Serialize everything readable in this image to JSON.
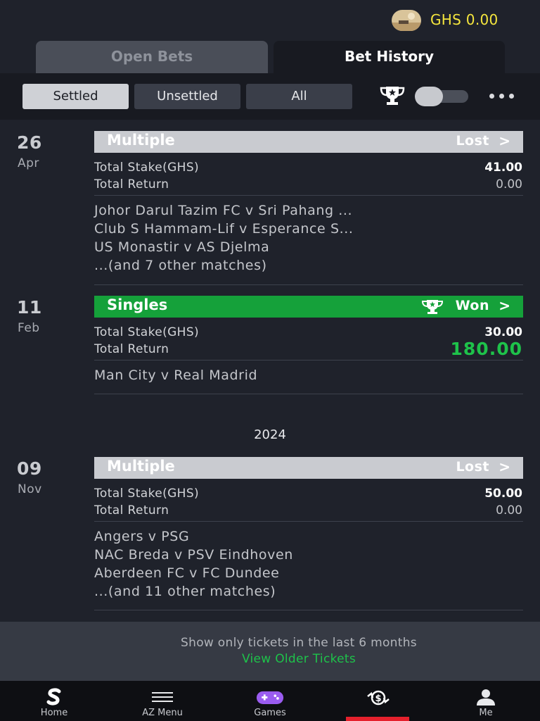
{
  "header": {
    "balance": "GHS 0.00"
  },
  "tabs": [
    {
      "label": "Open Bets"
    },
    {
      "label": "Bet History"
    }
  ],
  "filters": [
    {
      "label": "Settled"
    },
    {
      "label": "Unsettled"
    },
    {
      "label": "All"
    }
  ],
  "bets": [
    {
      "day": "26",
      "month": "Apr",
      "type": "Multiple",
      "status": "Lost",
      "stake_label": "Total Stake(GHS)",
      "stake": "41.00",
      "return_label": "Total Return",
      "return": "0.00",
      "matches": [
        "Johor Darul Tazim FC v Sri Pahang ...",
        "Club S Hammam-Lif v Esperance S...",
        "US Monastir v AS Djelma",
        "...(and 7 other matches)"
      ]
    },
    {
      "day": "11",
      "month": "Feb",
      "type": "Singles",
      "status": "Won",
      "stake_label": "Total Stake(GHS)",
      "stake": "30.00",
      "return_label": "Total Return",
      "return": "180.00",
      "matches": [
        "Man City v Real Madrid"
      ]
    },
    {
      "day": "09",
      "month": "Nov",
      "type": "Multiple",
      "status": "Lost",
      "stake_label": "Total Stake(GHS)",
      "stake": "50.00",
      "return_label": "Total Return",
      "return": "0.00",
      "matches": [
        "Angers v PSG",
        "NAC Breda v PSV Eindhoven",
        "Aberdeen FC v FC Dundee",
        "...(and 11 other matches)"
      ]
    }
  ],
  "year_separator": "2024",
  "older": {
    "note": "Show only tickets in the last 6 months",
    "link": "View Older Tickets"
  },
  "nav": [
    {
      "label": "Home",
      "icon": "sporty-logo-icon"
    },
    {
      "label": "AZ Menu",
      "icon": "menu-icon"
    },
    {
      "label": "Games",
      "icon": "gamepad-icon"
    },
    {
      "label": "",
      "icon": "cashout-icon"
    },
    {
      "label": "Me",
      "icon": "user-icon"
    }
  ],
  "colors": {
    "won": "#15a13a",
    "lost": "#c9cbd0",
    "balance": "#f5e63d",
    "accent_red": "#e5202c",
    "link_green": "#1ec24a"
  }
}
